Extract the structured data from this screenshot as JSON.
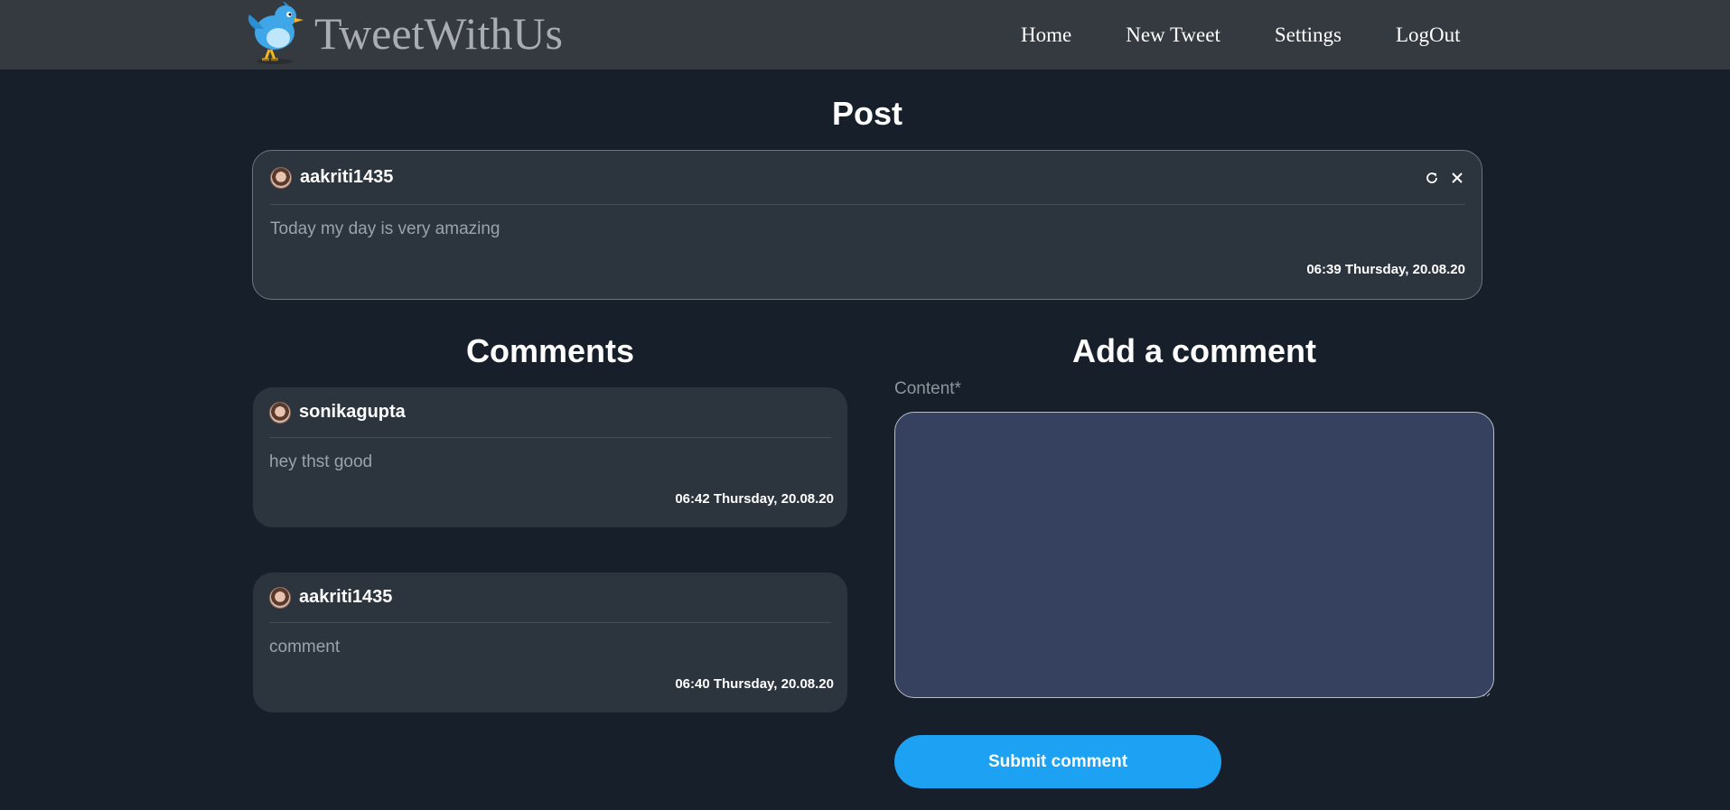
{
  "navbar": {
    "brand": "TweetWithUs",
    "links": [
      "Home",
      "New Tweet",
      "Settings",
      "LogOut"
    ]
  },
  "post": {
    "title": "Post",
    "username": "aakriti1435",
    "content": "Today my day is very amazing",
    "time": "06:39 Thursday, 20.08.20",
    "icons": [
      "refresh-icon",
      "close-icon"
    ]
  },
  "comments": {
    "title": "Comments",
    "items": [
      {
        "username": "sonikagupta",
        "content": "hey thst good",
        "time": "06:42 Thursday, 20.08.20"
      },
      {
        "username": "aakriti1435",
        "content": "comment",
        "time": "06:40 Thursday, 20.08.20"
      }
    ]
  },
  "add_comment": {
    "title": "Add a comment",
    "label": "Content*",
    "value": "",
    "submit_label": "Submit comment"
  },
  "colors": {
    "background": "#17202a",
    "navbar": "#343a40",
    "card": "#2c343e",
    "textarea": "#36405f",
    "accent": "#1da1f2"
  }
}
